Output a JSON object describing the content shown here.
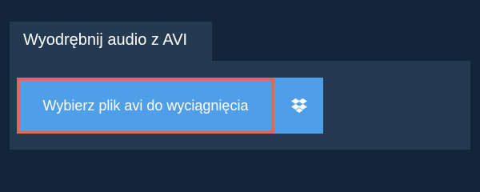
{
  "tab": {
    "title": "Wyodrębnij audio z AVI"
  },
  "upload": {
    "choose_label": "Wybierz plik avi do wyciągnięcia",
    "dropbox_icon": "dropbox-icon"
  },
  "colors": {
    "background": "#13253a",
    "panel": "#233a51",
    "button": "#4f9fe8",
    "focus_outline": "#e4655f",
    "text": "#ffffff"
  }
}
